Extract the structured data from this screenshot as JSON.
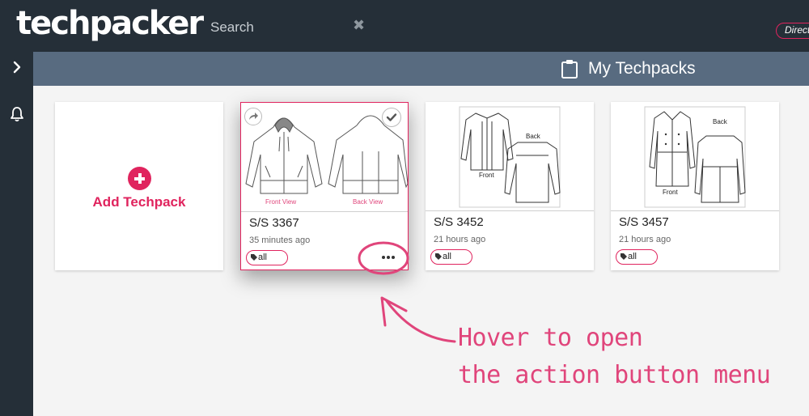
{
  "app": {
    "logo": "techpacker"
  },
  "search": {
    "placeholder": "Search",
    "clear_icon": "close-icon"
  },
  "directory": {
    "label": "Directory"
  },
  "page": {
    "title": "My Techpacks",
    "title_icon": "clipboard-icon"
  },
  "sidebar": {
    "expand_icon": "chevron-right-icon",
    "notifications_icon": "bell-icon"
  },
  "add_card": {
    "label": "Add Techpack",
    "icon": "plus-circle-icon"
  },
  "techpacks": [
    {
      "style": "S/S 3367",
      "updated": "35 minutes ago",
      "tag": "all",
      "front_label": "Front View",
      "back_label": "Back View"
    },
    {
      "style": "S/S 3452",
      "updated": "21 hours ago",
      "tag": "all",
      "front_label": "Front",
      "back_label": "Back"
    },
    {
      "style": "S/S 3457",
      "updated": "21 hours ago",
      "tag": "all",
      "front_label": "Front",
      "back_label": "Back"
    }
  ],
  "annotation": {
    "line1": "Hover to open",
    "line2": "the action button menu"
  },
  "colors": {
    "accent": "#e0245e",
    "topbar": "#252f38",
    "pagebar": "#586b80",
    "annotation": "#e0457b"
  }
}
